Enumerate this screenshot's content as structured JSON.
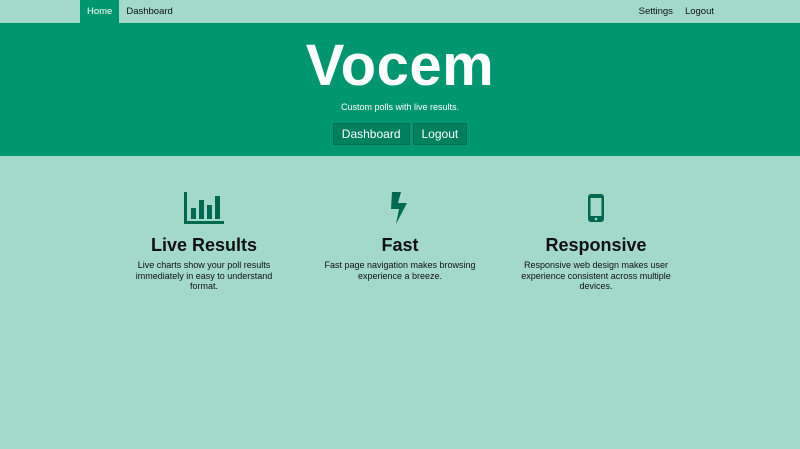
{
  "nav": {
    "left": [
      {
        "label": "Home",
        "active": true
      },
      {
        "label": "Dashboard",
        "active": false
      }
    ],
    "right": [
      {
        "label": "Settings"
      },
      {
        "label": "Logout"
      }
    ]
  },
  "hero": {
    "title": "Vocem",
    "subtitle": "Custom polls with live results.",
    "buttons": [
      "Dashboard",
      "Logout"
    ]
  },
  "features": [
    {
      "icon": "bar-chart-icon",
      "title": "Live Results",
      "description": "Live charts show your poll results immediately in easy to understand format."
    },
    {
      "icon": "lightning-bolt-icon",
      "title": "Fast",
      "description": "Fast page navigation makes browsing experience a breeze."
    },
    {
      "icon": "mobile-phone-icon",
      "title": "Responsive",
      "description": "Responsive web design makes user experience consistent across multiple devices."
    }
  ],
  "colors": {
    "background": "#a3d9c9",
    "hero": "#009670",
    "button": "#00805f",
    "icon": "#00694f"
  }
}
